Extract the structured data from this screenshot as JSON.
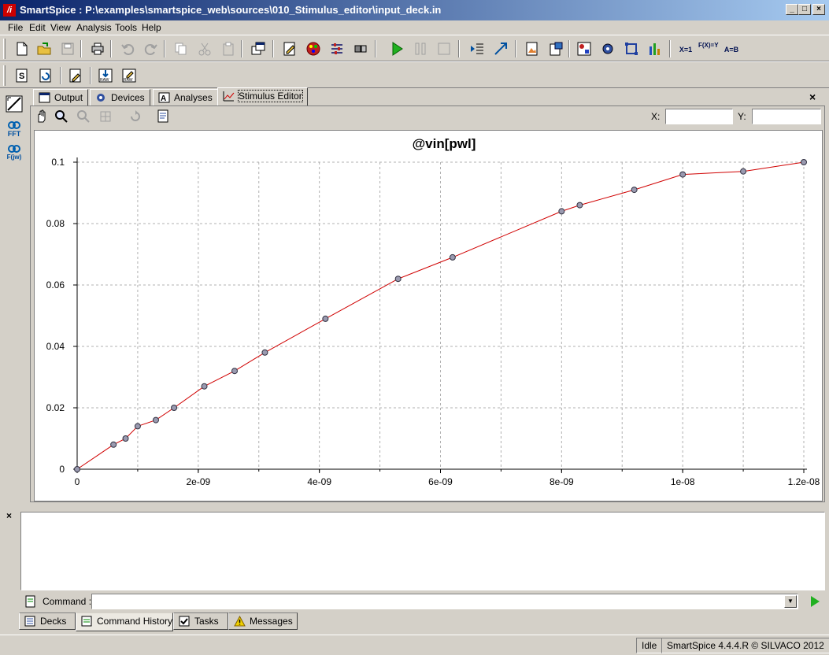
{
  "window": {
    "title": "SmartSpice : P:\\examples\\smartspice_web\\sources\\010_Stimulus_editor\\input_deck.in"
  },
  "menu": [
    "File",
    "Edit",
    "View",
    "Analysis",
    "Tools",
    "Help"
  ],
  "left_tools": {
    "fft_label": "FFT",
    "fjw_label": "F(jw)"
  },
  "toolbar2": {
    "raw1": "RAW",
    "raw2": "RAW"
  },
  "toolbar1": {
    "x_eq": "X=1",
    "fx_eq": "F(X)=Y",
    "ab_eq": "A=B"
  },
  "tabs": [
    {
      "label": "Output",
      "icon": "output-window-icon"
    },
    {
      "label": "Devices",
      "icon": "devices-icon"
    },
    {
      "label": "Analyses",
      "icon": "analyses-icon"
    },
    {
      "label": "Stimulus Editor",
      "icon": "stimulus-chart-icon",
      "active": true
    }
  ],
  "coords": {
    "x_label": "X:",
    "y_label": "Y:",
    "x_value": "",
    "y_value": ""
  },
  "chart_data": {
    "type": "line",
    "title": "@vin[pwl]",
    "xlabel": "",
    "ylabel": "",
    "xlim": [
      0,
      1.2e-08
    ],
    "ylim": [
      0,
      0.1
    ],
    "x_ticks": [
      "0",
      "2e-09",
      "4e-09",
      "6e-09",
      "8e-09",
      "1e-08",
      "1.2e-08"
    ],
    "y_ticks": [
      "0",
      "0.02",
      "0.04",
      "0.06",
      "0.08",
      "0.1"
    ],
    "grid": true,
    "series": [
      {
        "color": "#d00000",
        "marker_color": "#9a9ab0",
        "x": [
          0,
          6e-10,
          8e-10,
          1e-09,
          1.3e-09,
          1.6e-09,
          2.1e-09,
          2.6e-09,
          3.1e-09,
          4.1e-09,
          5.3e-09,
          6.2e-09,
          8e-09,
          8.3e-09,
          9.2e-09,
          1e-08,
          1.1e-08,
          1.2e-08
        ],
        "y": [
          0,
          0.008,
          0.01,
          0.014,
          0.016,
          0.02,
          0.027,
          0.032,
          0.038,
          0.049,
          0.062,
          0.069,
          0.084,
          0.086,
          0.091,
          0.096,
          0.097,
          0.1
        ]
      }
    ]
  },
  "command": {
    "label": "Command :",
    "value": ""
  },
  "bottom_tabs": [
    {
      "label": "Decks",
      "icon": "decks-icon"
    },
    {
      "label": "Command History",
      "icon": "command-history-icon",
      "active": true
    },
    {
      "label": "Tasks",
      "icon": "tasks-icon"
    },
    {
      "label": "Messages",
      "icon": "warning-icon"
    }
  ],
  "status": {
    "state": "Idle",
    "version": "SmartSpice 4.4.4.R © SILVACO 2012"
  }
}
